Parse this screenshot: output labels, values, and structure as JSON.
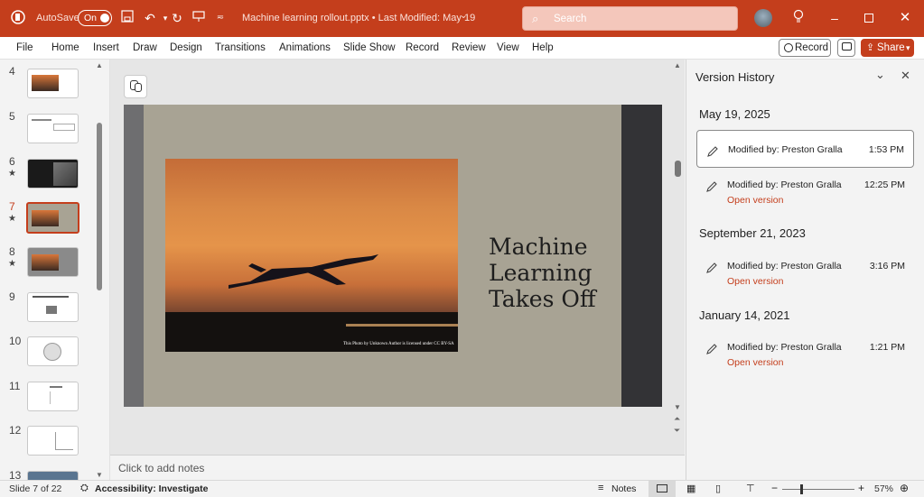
{
  "titlebar": {
    "autosave_label": "AutoSave",
    "autosave_state": "On",
    "doc_title": "Machine learning rollout.pptx • Last Modified: May 19",
    "search_placeholder": "Search"
  },
  "menu": {
    "items": [
      "File",
      "Home",
      "Insert",
      "Draw",
      "Design",
      "Transitions",
      "Animations",
      "Slide Show",
      "Record",
      "Review",
      "View",
      "Help"
    ],
    "record_button": "Record",
    "share_button": "Share"
  },
  "thumbnails": [
    {
      "num": "4",
      "star": ""
    },
    {
      "num": "5",
      "star": ""
    },
    {
      "num": "6",
      "star": "★"
    },
    {
      "num": "7",
      "star": "★"
    },
    {
      "num": "8",
      "star": "★"
    },
    {
      "num": "9",
      "star": ""
    },
    {
      "num": "10",
      "star": ""
    },
    {
      "num": "11",
      "star": ""
    },
    {
      "num": "12",
      "star": ""
    },
    {
      "num": "13",
      "star": ""
    }
  ],
  "slide": {
    "title_line1": "Machine",
    "title_line2": "Learning",
    "title_line3": "Takes Off",
    "credit": "This Photo by Unknown Author is licensed under CC BY-SA"
  },
  "notes_placeholder": "Click to add notes",
  "version_history": {
    "title": "Version History",
    "groups": [
      {
        "date": "May 19, 2025",
        "entries": [
          {
            "modified": "Modified by: Preston Gralla",
            "time": "1:53 PM",
            "open": ""
          },
          {
            "modified": "Modified by: Preston Gralla",
            "time": "12:25 PM",
            "open": "Open version"
          }
        ]
      },
      {
        "date": "September 21, 2023",
        "entries": [
          {
            "modified": "Modified by: Preston Gralla",
            "time": "3:16 PM",
            "open": "Open version"
          }
        ]
      },
      {
        "date": "January 14, 2021",
        "entries": [
          {
            "modified": "Modified by: Preston Gralla",
            "time": "1:21 PM",
            "open": "Open version"
          }
        ]
      }
    ]
  },
  "status": {
    "slide_of": "Slide 7 of 22",
    "accessibility": "Accessibility: Investigate",
    "notes": "Notes",
    "zoom": "57%"
  },
  "colors": {
    "accent": "#c43e1c",
    "slide_bg": "#a8a394"
  }
}
